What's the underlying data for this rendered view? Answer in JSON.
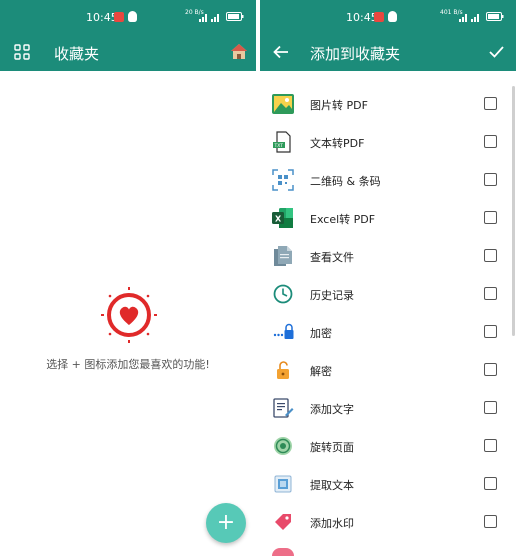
{
  "left": {
    "status_time": "10:45",
    "net_speed": "20 B/s",
    "title": "收藏夹",
    "empty_message": "选择 + 图标添加您最喜欢的功能!",
    "fab_label": "+"
  },
  "right": {
    "status_time": "10:45",
    "net_speed": "401 B/s",
    "title": "添加到收藏夹",
    "items": [
      {
        "label": "图片转 PDF",
        "icon": "image-icon",
        "checked": false
      },
      {
        "label": "文本转PDF",
        "icon": "text-to-pdf-icon",
        "checked": false
      },
      {
        "label": "二维码 & 条码",
        "icon": "qr-scan-icon",
        "checked": false
      },
      {
        "label": "Excel转 PDF",
        "icon": "excel-icon",
        "checked": false
      },
      {
        "label": "查看文件",
        "icon": "view-files-icon",
        "checked": false
      },
      {
        "label": "历史记录",
        "icon": "history-icon",
        "checked": false
      },
      {
        "label": "加密",
        "icon": "encrypt-icon",
        "checked": false
      },
      {
        "label": "解密",
        "icon": "decrypt-icon",
        "checked": false
      },
      {
        "label": "添加文字",
        "icon": "add-text-icon",
        "checked": false
      },
      {
        "label": "旋转页面",
        "icon": "rotate-page-icon",
        "checked": false
      },
      {
        "label": "提取文本",
        "icon": "extract-text-icon",
        "checked": false
      },
      {
        "label": "添加水印",
        "icon": "watermark-icon",
        "checked": false
      }
    ]
  },
  "colors": {
    "toolbar": "#1c8c7a",
    "fab": "#57c9b7",
    "heart": "#e02a2a"
  }
}
